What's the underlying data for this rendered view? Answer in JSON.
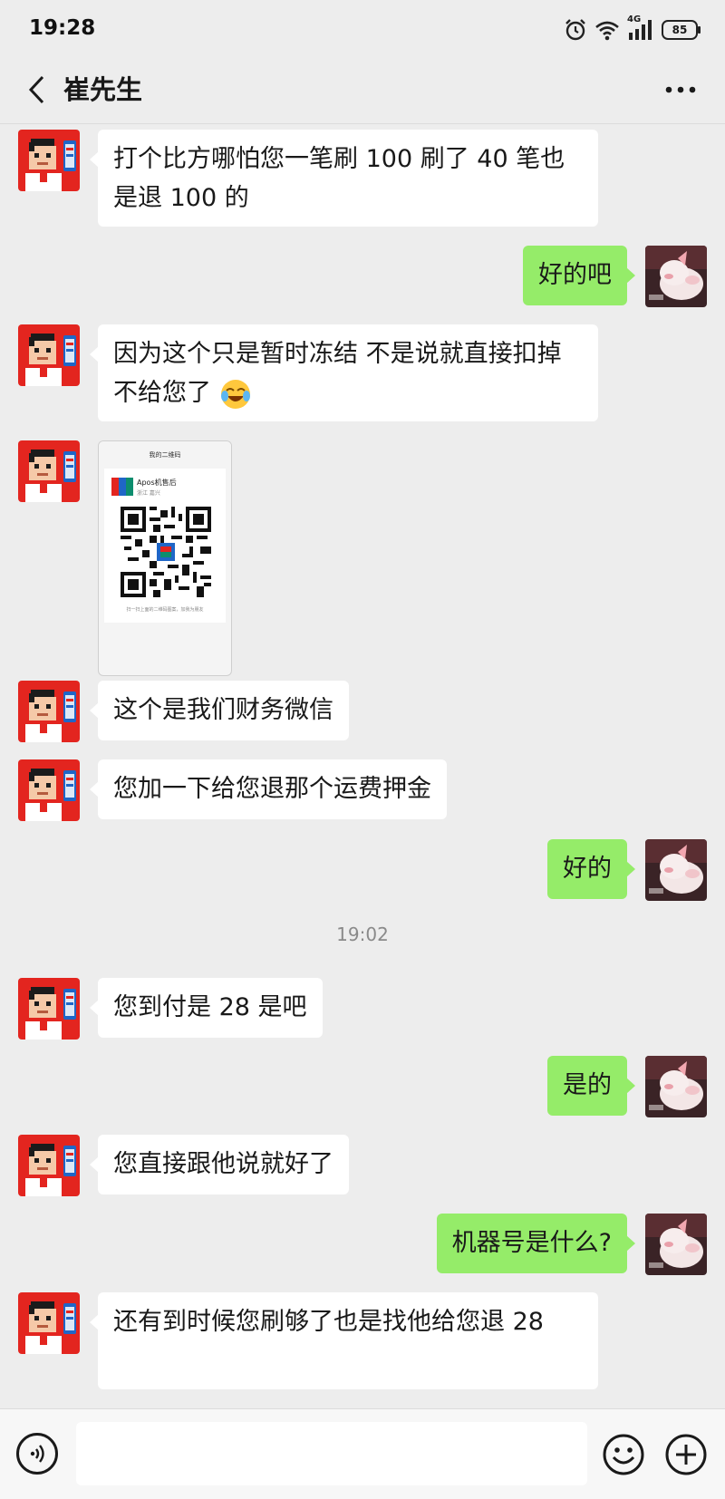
{
  "status_bar": {
    "time": "19:28",
    "battery": "85",
    "network": "4G"
  },
  "header": {
    "title": "崔先生"
  },
  "messages": [
    {
      "side": "in",
      "text": "打个比方哪怕您一笔刷 100 刷了 40 笔也是退 100 的"
    },
    {
      "side": "out",
      "text": "好的吧"
    },
    {
      "side": "in",
      "text": "因为这个只是暂时冻结 不是说就直接扣掉不给您了",
      "emoji": "crying-laughing-emoji"
    },
    {
      "side": "in",
      "type": "image",
      "image": {
        "top_bar": "我的二维码",
        "merchant": "Apos机售后",
        "region": "浙江 嘉兴",
        "caption": "扫一扫上面的二维码图案，加我为朋友"
      }
    },
    {
      "side": "in",
      "text": "这个是我们财务微信"
    },
    {
      "side": "in",
      "text": "您加一下给您退那个运费押金"
    },
    {
      "side": "out",
      "text": "好的"
    },
    {
      "type": "time",
      "text": "19:02"
    },
    {
      "side": "in",
      "text": "您到付是 28 是吧"
    },
    {
      "side": "out",
      "text": "是的"
    },
    {
      "side": "in",
      "text": "您直接跟他说就好了"
    },
    {
      "side": "out",
      "text": "机器号是什么?"
    },
    {
      "side": "in",
      "text": "还有到时候您刷够了也是找他给您退 28"
    }
  ],
  "input": {
    "placeholder": ""
  },
  "colors": {
    "background": "#ededed",
    "bubble_out": "#95ec69",
    "bubble_in": "#ffffff",
    "avatar_bg": "#e3251f"
  }
}
